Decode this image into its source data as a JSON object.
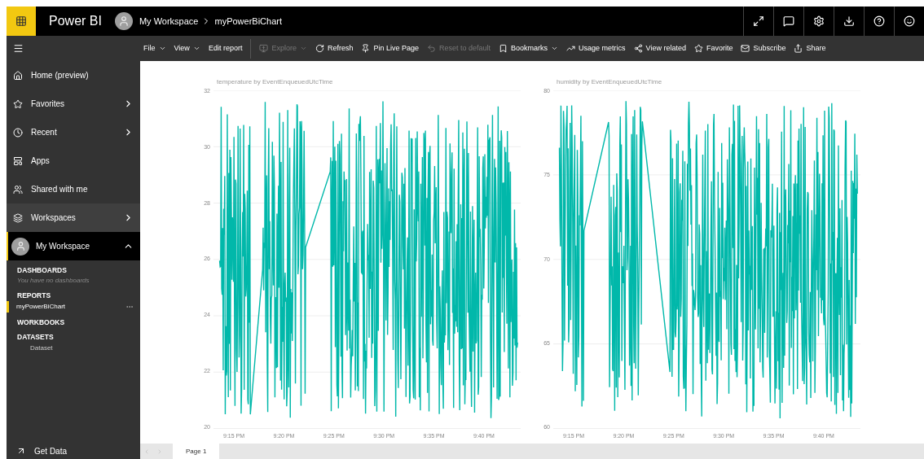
{
  "app": {
    "name": "Power BI"
  },
  "breadcrumb": [
    "My Workspace",
    "myPowerBiChart"
  ],
  "toolbar": [
    {
      "label": "File",
      "kind": "menu",
      "disabled": false
    },
    {
      "label": "View",
      "kind": "menu",
      "disabled": false
    },
    {
      "label": "Edit report",
      "kind": "button",
      "disabled": false
    },
    {
      "label": "Explore",
      "kind": "menu",
      "disabled": true
    },
    {
      "label": "Refresh",
      "kind": "button",
      "disabled": false
    },
    {
      "label": "Pin Live Page",
      "kind": "button",
      "disabled": false
    },
    {
      "label": "Reset to default",
      "kind": "button",
      "disabled": true
    },
    {
      "label": "Bookmarks",
      "kind": "menu",
      "disabled": false
    },
    {
      "label": "Usage metrics",
      "kind": "button",
      "disabled": false
    },
    {
      "label": "View related",
      "kind": "button",
      "disabled": false
    },
    {
      "label": "Favorite",
      "kind": "button",
      "disabled": false
    },
    {
      "label": "Subscribe",
      "kind": "button",
      "disabled": false
    },
    {
      "label": "Share",
      "kind": "button",
      "disabled": false
    }
  ],
  "nav": [
    {
      "label": "Home (preview)",
      "kind": "link",
      "selected": false
    },
    {
      "label": "Favorites",
      "kind": "submenu",
      "selected": false
    },
    {
      "label": "Recent",
      "kind": "submenu",
      "selected": false
    },
    {
      "label": "Apps",
      "kind": "link",
      "selected": false
    },
    {
      "label": "Shared with me",
      "kind": "link",
      "selected": false
    },
    {
      "label": "Workspaces",
      "kind": "submenu",
      "selected": true
    }
  ],
  "workspace": {
    "label": "My Workspace",
    "expanded": true,
    "sections": [
      {
        "heading": "DASHBOARDS",
        "items": [
          {
            "label": "You have no dashboards",
            "kind": "empty"
          }
        ]
      },
      {
        "heading": "REPORTS",
        "items": [
          {
            "label": "myPowerBiChart",
            "kind": "report",
            "selected": true
          }
        ]
      },
      {
        "heading": "WORKBOOKS"
      },
      {
        "heading": "DATASETS",
        "items": [
          {
            "label": "Dataset",
            "kind": "dataset",
            "selected": false
          }
        ]
      }
    ]
  },
  "get_data": "Get Data",
  "charts": [
    {
      "title": "temperature by EventEnqueuedUtcTime",
      "y_ticks": [
        "32",
        "30",
        "28",
        "26",
        "24",
        "22",
        "20"
      ],
      "x_ticks": [
        "9:15 PM",
        "9:20 PM",
        "9:25 PM",
        "9:30 PM",
        "9:35 PM",
        "9:40 PM"
      ]
    },
    {
      "title": "humidity by EventEnqueuedUtcTime",
      "y_ticks": [
        "80",
        "75",
        "70",
        "65",
        "60"
      ],
      "x_ticks": [
        "9:15 PM",
        "9:20 PM",
        "9:25 PM",
        "9:30 PM",
        "9:35 PM",
        "9:40 PM"
      ]
    }
  ],
  "pages": [
    {
      "label": "Page 1",
      "selected": true
    }
  ]
}
